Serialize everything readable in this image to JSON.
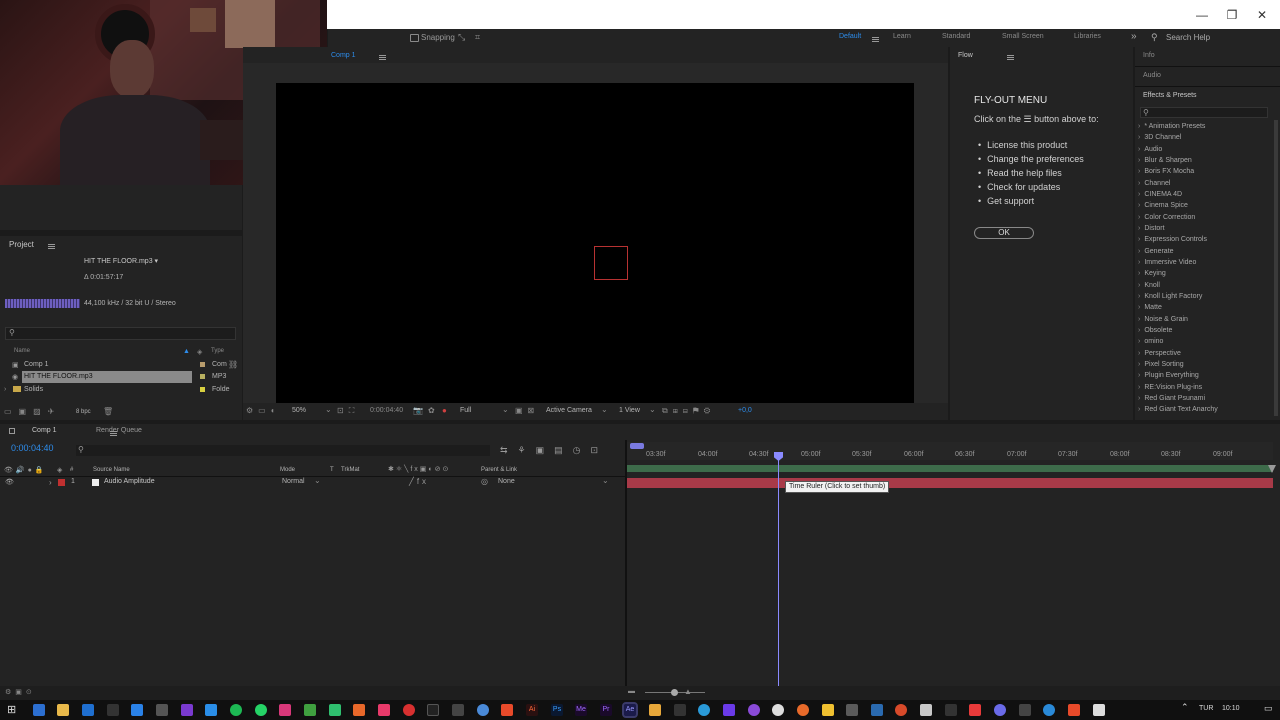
{
  "window": {
    "minimize": "—",
    "maximize": "❐",
    "close": "✕"
  },
  "toolbar": {
    "snapping": "Snapping",
    "workspaces": [
      "Default",
      "Learn",
      "Standard",
      "Small Screen",
      "Libraries"
    ],
    "active_workspace": "Default",
    "search_help": "Search Help"
  },
  "comp_tab": "Comp 1",
  "project": {
    "title": "Project",
    "file_name": "HIT THE FLOOR.mp3 ▾",
    "duration": "Δ 0:01:57:17",
    "audio_info": "44,100 kHz / 32 bit U / Stereo",
    "columns": {
      "name": "Name",
      "type": "Type"
    },
    "items": [
      {
        "name": "Comp 1",
        "type": "Com"
      },
      {
        "name": "HIT THE FLOOR.mp3",
        "type": "MP3"
      },
      {
        "name": "Solids",
        "type": "Folde"
      }
    ],
    "bpc": "8 bpc"
  },
  "viewer_bar": {
    "zoom": "50%",
    "timecode": "0:00:04:40",
    "resolution": "Full",
    "camera": "Active Camera",
    "views": "1 View",
    "exposure": "+0,0"
  },
  "flow": {
    "tab": "Flow",
    "title": "FLY-OUT MENU",
    "intro": "Click on the  ☰  button above to:",
    "items": [
      "License this product",
      "Change the preferences",
      "Read the help files",
      "Check for updates",
      "Get support"
    ],
    "ok": "OK"
  },
  "right_panel": {
    "info": "Info",
    "audio": "Audio",
    "effects_title": "Effects & Presets",
    "effects": [
      "* Animation Presets",
      "3D Channel",
      "Audio",
      "Blur & Sharpen",
      "Boris FX Mocha",
      "Channel",
      "CINEMA 4D",
      "Cinema Spice",
      "Color Correction",
      "Distort",
      "Expression Controls",
      "Generate",
      "Immersive Video",
      "Keying",
      "Knoll",
      "Knoll Light Factory",
      "Matte",
      "Noise & Grain",
      "Obsolete",
      "omino",
      "Perspective",
      "Pixel Sorting",
      "Plugin Everything",
      "RE:Vision Plug-ins",
      "Red Giant Psunami",
      "Red Giant Text Anarchy"
    ]
  },
  "timeline": {
    "tabs": [
      "Comp 1",
      "Render Queue"
    ],
    "timecode": "0:00:04:40",
    "columns": {
      "num": "#",
      "source": "Source Name",
      "mode": "Mode",
      "t": "T",
      "trkmat": "TrkMat",
      "parent": "Parent & Link"
    },
    "layer": {
      "num": "1",
      "name": "Audio Amplitude",
      "mode": "Normal",
      "parent": "None"
    },
    "ruler": [
      "03:30f",
      "04:00f",
      "04:30f",
      "05:00f",
      "05:30f",
      "06:00f",
      "06:30f",
      "07:00f",
      "07:30f",
      "08:00f",
      "08:30f",
      "09:00f"
    ],
    "tooltip": "Time Ruler (Click to set thumb)"
  },
  "taskbar": {
    "lang": "TUR",
    "time": "10:10"
  }
}
